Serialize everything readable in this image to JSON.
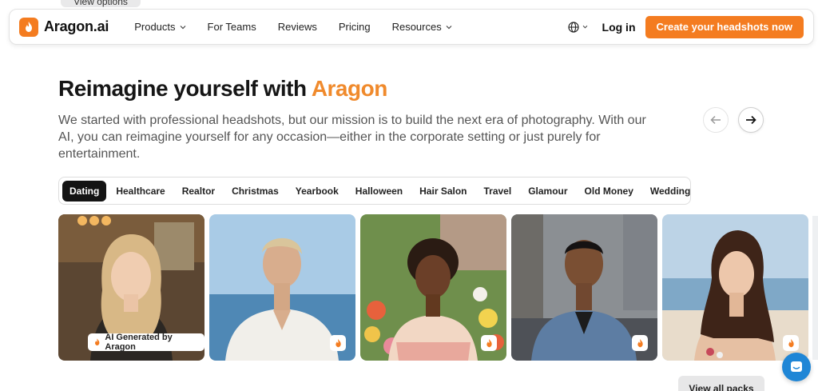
{
  "top_tab": {
    "label": "View options"
  },
  "navbar": {
    "brand": "Aragon.ai",
    "items": [
      {
        "label": "Products",
        "has_dropdown": true
      },
      {
        "label": "For Teams",
        "has_dropdown": false
      },
      {
        "label": "Reviews",
        "has_dropdown": false
      },
      {
        "label": "Pricing",
        "has_dropdown": false
      },
      {
        "label": "Resources",
        "has_dropdown": true
      }
    ],
    "language_icon": "globe-icon",
    "login_label": "Log in",
    "cta_label": "Create your headshots now"
  },
  "hero": {
    "headline_prefix": "Reimagine yourself with ",
    "headline_accent": "Aragon",
    "subhead": "We started with professional headshots, but our mission is to build the next era of photography. With our AI, you can reimagine yourself for any occasion—either in the corporate setting or just purely for entertainment."
  },
  "carousel_controls": {
    "prev_icon": "arrow-left-icon",
    "next_icon": "arrow-right-icon"
  },
  "categories": [
    "Dating",
    "Healthcare",
    "Realtor",
    "Christmas",
    "Yearbook",
    "Halloween",
    "Hair Salon",
    "Travel",
    "Glamour",
    "Old Money",
    "Wedding"
  ],
  "active_category": "Dating",
  "cards": [
    {
      "name": "dating-photo-woman-blonde-cafe",
      "badge": "AI Generated by Aragon"
    },
    {
      "name": "dating-photo-man-white-shirt-sea"
    },
    {
      "name": "dating-photo-woman-garden"
    },
    {
      "name": "dating-photo-man-denim-street"
    },
    {
      "name": "dating-photo-woman-beach"
    }
  ],
  "view_all_label": "View all packs",
  "colors": {
    "brand_orange": "#f47c20",
    "accent_text": "#f08a2c",
    "chat_blue": "#1f86d6"
  }
}
